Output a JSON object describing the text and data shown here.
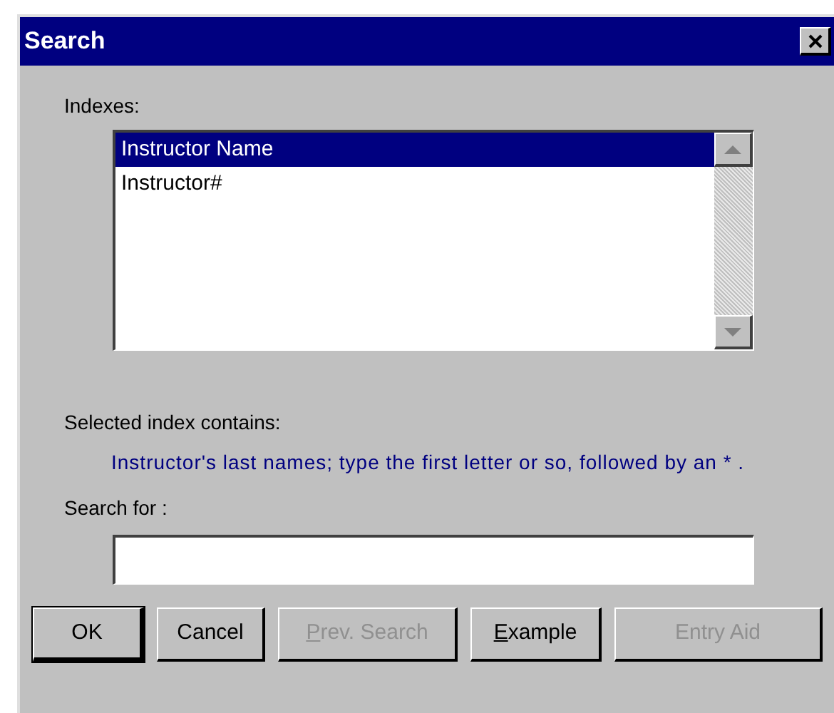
{
  "window": {
    "title": "Search"
  },
  "indexes": {
    "label": "Indexes:",
    "items": [
      {
        "label": "Instructor Name",
        "selected": true
      },
      {
        "label": "Instructor#",
        "selected": false
      }
    ]
  },
  "description": {
    "label": "Selected index contains:",
    "text": "Instructor's last names; type the first letter or so, followed by an * ."
  },
  "search": {
    "label": "Search for :"
  },
  "buttons": [
    {
      "rest": "OK",
      "disabled": false,
      "default": true
    },
    {
      "rest": "Cancel",
      "disabled": false,
      "default": false
    },
    {
      "accel": "P",
      "rest": "rev. Search",
      "disabled": true,
      "default": false
    },
    {
      "accel": "E",
      "rest": "xample",
      "disabled": false,
      "default": false
    },
    {
      "rest": "Entry Aid",
      "disabled": true,
      "default": false
    }
  ]
}
